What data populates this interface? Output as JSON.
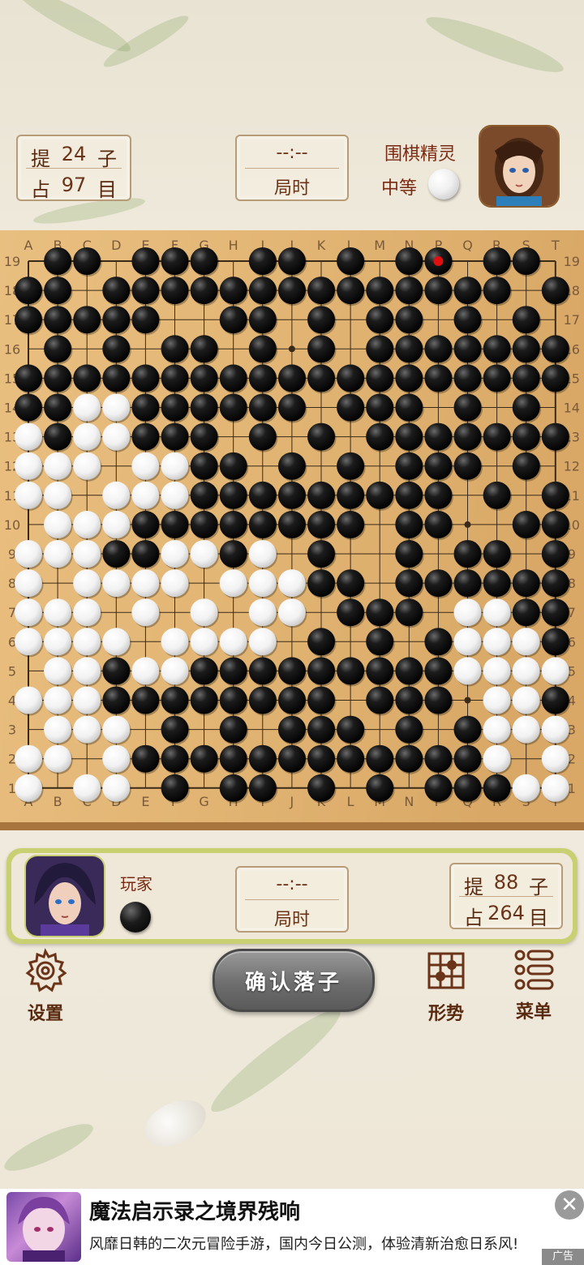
{
  "opponent": {
    "name": "围棋精灵",
    "level": "中等",
    "stone": "white",
    "captures_label": "提",
    "captures": "24",
    "captures_unit": "子",
    "territory_label": "占",
    "territory": "97",
    "territory_unit": "目",
    "timer": "--:--",
    "timer_label": "局时"
  },
  "player": {
    "name": "玩家",
    "stone": "black",
    "captures_label": "提",
    "captures": "88",
    "captures_unit": "子",
    "territory_label": "占",
    "territory": "264",
    "territory_unit": "目",
    "timer": "--:--",
    "timer_label": "局时"
  },
  "board": {
    "size": 19,
    "columns": [
      "A",
      "B",
      "C",
      "D",
      "E",
      "F",
      "G",
      "H",
      "I",
      "J",
      "K",
      "L",
      "M",
      "N",
      "P",
      "Q",
      "R",
      "S",
      "T"
    ],
    "rows_top_to_bottom": [
      "19",
      "18",
      "17",
      "16",
      "15",
      "14",
      "13",
      "12",
      "11",
      "10",
      "9",
      "8",
      "7",
      "6",
      "5",
      "4",
      "3",
      "2",
      "1"
    ],
    "last_move": "P19",
    "grid": [
      ".BB.BBB.BB.B.BB.BB.",
      "BB.BBBBBBBBBBBBBB.B",
      "BBBBB..BB.B.BB.B.B.",
      ".B.B.BB.B.B.BBBBBBB",
      "BBBBBBBBBBBBBBBBBBB",
      "BBWWBBBBBB.BBB.B.B.",
      "WBWWBBB.B.B.BBBBBBB",
      "WWW.WWBB.B.B.BBB.B.",
      "WW.WWWBBBBBBBBB.B.B",
      ".WWWBBBBBBBB.BB..BB",
      "WWWBBWWBW.B..B.BB.B",
      "W.WWWW.WWWBB.BBBBBB",
      "WWW.W.W.WW.BBB.WWBB",
      "WWWW.WWWW.B.B.BWWWB",
      ".WWBWWBBBBBBBBBWWWW",
      "WWWBBBBBBBB.BBB.WWB",
      ".WWW.B.B.BBB.B.BWWW",
      "WW.WBBBBBBBBBBBBW.W",
      "W.WW.B.BB.B.B.BBBWW"
    ]
  },
  "actions": {
    "confirm": "确认落子",
    "settings": "设置",
    "analysis": "形势",
    "menu": "菜单"
  },
  "ad": {
    "title": "魔法启示录之境界残响",
    "description": "风靡日韩的二次元冒险手游，国内今日公测，体验清新治愈日系风!",
    "tag": "广告",
    "close": "✕"
  },
  "icons": {
    "settings": "gear-icon",
    "analysis": "grid-board-icon",
    "menu": "list-icon",
    "close": "close-icon"
  },
  "colors": {
    "board": "#e2b574",
    "text_brown": "#5a2a10",
    "strip_green": "#c9d071"
  }
}
